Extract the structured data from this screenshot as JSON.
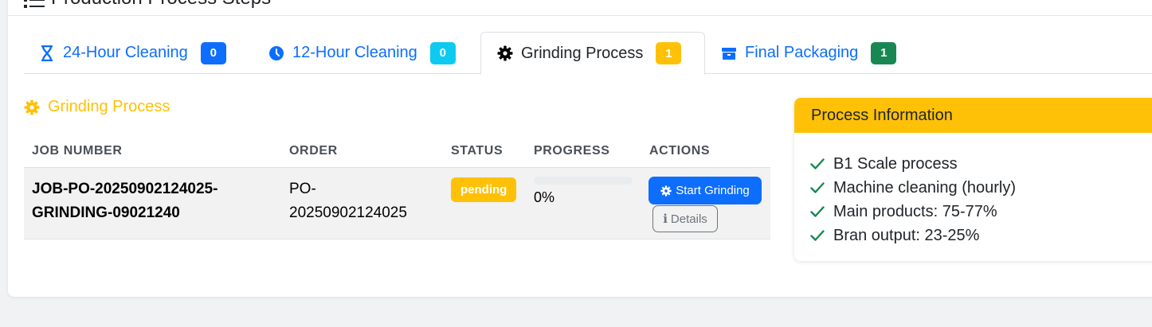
{
  "header": {
    "title": "Production Process Steps"
  },
  "tabs": [
    {
      "label": "24-Hour Cleaning",
      "icon": "hourglass-icon",
      "count": "0",
      "badge_color": "#0d6efd"
    },
    {
      "label": "12-Hour Cleaning",
      "icon": "clock-icon",
      "count": "0",
      "badge_color": "#0dcaf0"
    },
    {
      "label": "Grinding Process",
      "icon": "gear-icon",
      "count": "1",
      "badge_color": "#ffc107",
      "active": true
    },
    {
      "label": "Final Packaging",
      "icon": "box-icon",
      "count": "1",
      "badge_color": "#198754"
    }
  ],
  "section": {
    "title": "Grinding Process",
    "icon": "gear-icon"
  },
  "table": {
    "columns": [
      "JOB NUMBER",
      "ORDER",
      "STATUS",
      "PROGRESS",
      "ACTIONS"
    ],
    "rows": [
      {
        "job_line1": "JOB-PO-20250902124025-",
        "job_line2": "GRINDING-09021240",
        "order_line1": "PO-",
        "order_line2": "20250902124025",
        "status": "pending",
        "progress": 0,
        "progress_text": "0%",
        "start_label": "Start Grinding",
        "details_label": "Details"
      }
    ]
  },
  "info_panel": {
    "title": "Process Information",
    "items": [
      "B1 Scale process",
      "Machine cleaning (hourly)",
      "Main products: 75-77%",
      "Bran output: 23-25%"
    ]
  },
  "colors": {
    "primary": "#0d6efd",
    "warning": "#ffc107",
    "success": "#198754",
    "info": "#0dcaf0"
  }
}
